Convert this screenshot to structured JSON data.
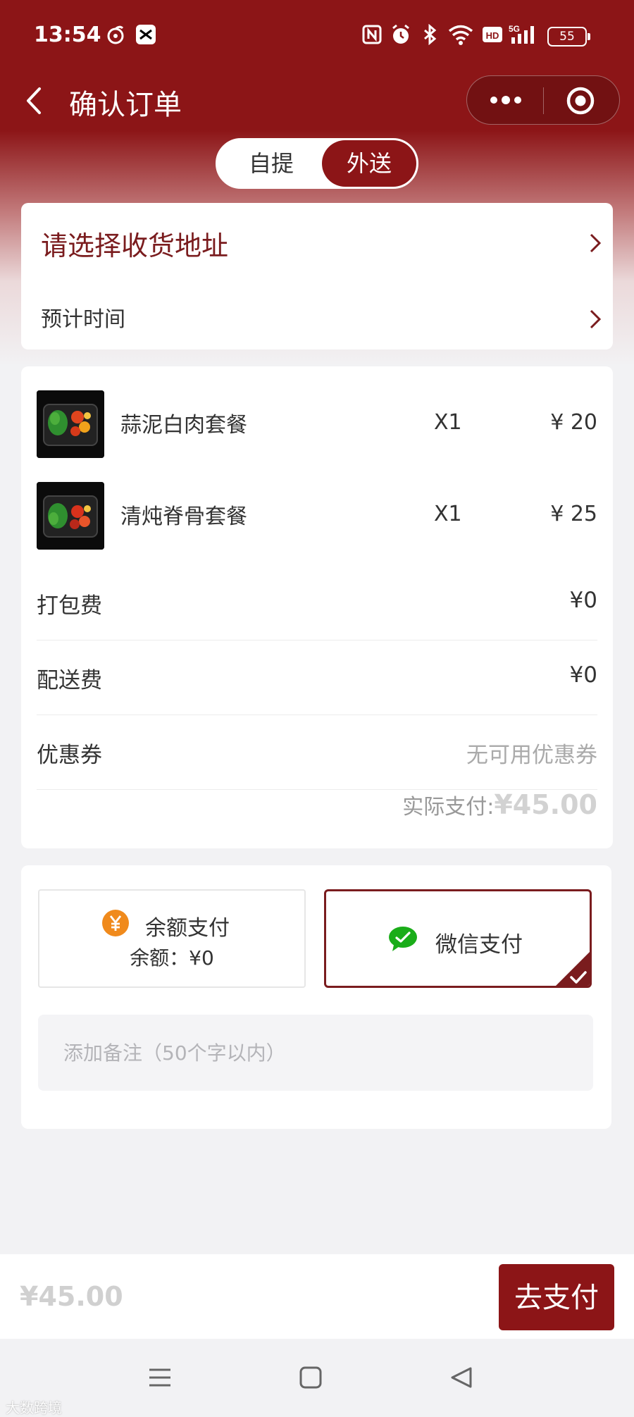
{
  "status_bar": {
    "time": "13:54",
    "battery": "55",
    "network": "5G"
  },
  "header": {
    "title": "确认订单",
    "back_icon": "chevron-left-icon",
    "more_icon": "more-dots-icon",
    "close_icon": "target-icon"
  },
  "mode_toggle": {
    "options": [
      "自提",
      "外送"
    ],
    "selected": "外送"
  },
  "address": {
    "label": "请选择收货地址",
    "eta_label": "预计时间"
  },
  "order": {
    "items": [
      {
        "name": "蒜泥白肉套餐",
        "qty": "X1",
        "price": "¥ 20"
      },
      {
        "name": "清炖脊骨套餐",
        "qty": "X1",
        "price": "¥ 25"
      }
    ],
    "fees": [
      {
        "label": "打包费",
        "value": "¥0"
      },
      {
        "label": "配送费",
        "value": "¥0"
      },
      {
        "label": "优惠券",
        "value": "无可用优惠券"
      }
    ],
    "actual_label": "实际支付:",
    "actual_amount": "¥45.00"
  },
  "payment": {
    "balance_label": "余额支付",
    "balance_text": "余额：¥0",
    "wechat_label": "微信支付",
    "selected": "微信支付",
    "note_placeholder": "添加备注（50个字以内）"
  },
  "bottom": {
    "total": "¥45.00",
    "pay_button": "去支付"
  },
  "watermark": "大数跨境",
  "colors": {
    "brand": "#8c1517",
    "brand_text": "#7a1c1e",
    "balance_icon": "#f08a1c",
    "wechat_icon": "#1aad19"
  }
}
